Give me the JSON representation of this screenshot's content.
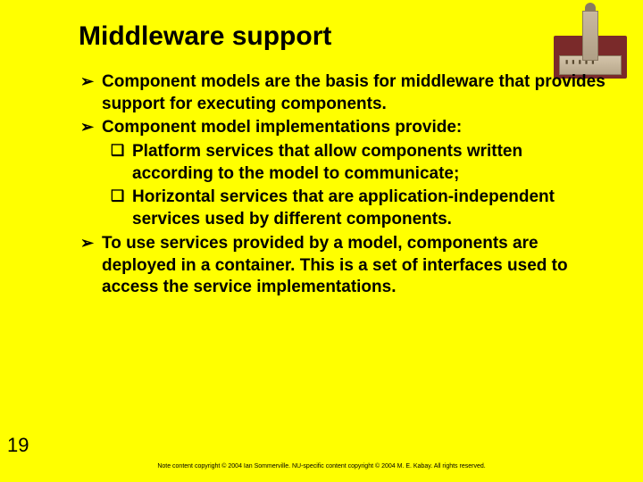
{
  "title": "Middleware support",
  "bullets": {
    "b1": "Component models are the basis for middleware that provides support for executing components.",
    "b2": "Component model implementations provide:",
    "b2a": "Platform services that allow components written according to the model to communicate;",
    "b2b": "Horizontal services that are application-independent services used by different components.",
    "b3": "To use services provided by a model, components are deployed in a container. This is a set of interfaces used to access the service implementations."
  },
  "page_number": "19",
  "footer": "Note content copyright © 2004 Ian Sommerville. NU-specific content copyright © 2004 M. E. Kabay. All rights reserved."
}
